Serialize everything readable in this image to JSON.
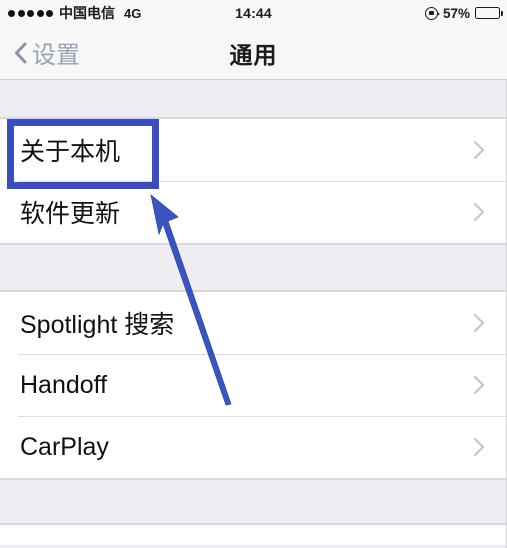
{
  "status_bar": {
    "signal_dots": 5,
    "carrier": "中国电信",
    "network": "4G",
    "time": "14:44",
    "battery_percent": "57%",
    "battery_level": 57,
    "rotation_lock_icon": "rotation-lock-icon"
  },
  "nav": {
    "back_label": "设置",
    "back_icon": "chevron-left-icon",
    "title": "通用"
  },
  "sections": [
    {
      "rows": [
        {
          "label": "关于本机",
          "chevron": "chevron-right-icon",
          "highlighted": true
        },
        {
          "label": "软件更新",
          "chevron": "chevron-right-icon",
          "highlighted": false
        }
      ]
    },
    {
      "rows": [
        {
          "label": "Spotlight 搜索",
          "chevron": "chevron-right-icon",
          "highlighted": false
        },
        {
          "label": "Handoff",
          "chevron": "chevron-right-icon",
          "highlighted": false
        },
        {
          "label": "CarPlay",
          "chevron": "chevron-right-icon",
          "highlighted": false
        }
      ]
    }
  ],
  "annotation": {
    "highlight_color": "#3b4cbf",
    "arrow_color": "#3b55c0",
    "arrow_label": "pointer-arrow",
    "highlight_target": "关于本机"
  },
  "colors": {
    "background": "#eeeef2",
    "cell": "#ffffff",
    "separator": "#dcdce1",
    "chevron": "#c6c6cb",
    "text": "#111114",
    "back_tint": "#9aa2b4"
  }
}
